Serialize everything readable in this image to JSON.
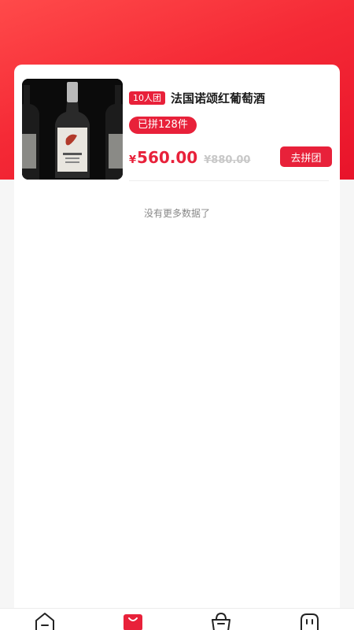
{
  "product": {
    "image": "wine-bottle-photo",
    "group_tag": "10人团",
    "title": "法国诺颂红葡萄酒",
    "joined": "已拼128件",
    "currency": "¥",
    "price": "560.00",
    "original_price": "¥880.00",
    "button_label": "去拼团"
  },
  "list": {
    "end_text": "没有更多数据了"
  },
  "tabbar": {
    "tabs": [
      {
        "icon": "home-icon",
        "active": false
      },
      {
        "icon": "shopping-bag-icon",
        "active": true
      },
      {
        "icon": "basket-icon",
        "active": false
      },
      {
        "icon": "chat-icon",
        "active": false
      }
    ]
  },
  "colors": {
    "accent": "#e8213a",
    "header_gradient_start": "#ff4a4a",
    "header_gradient_end": "#e8132a"
  }
}
